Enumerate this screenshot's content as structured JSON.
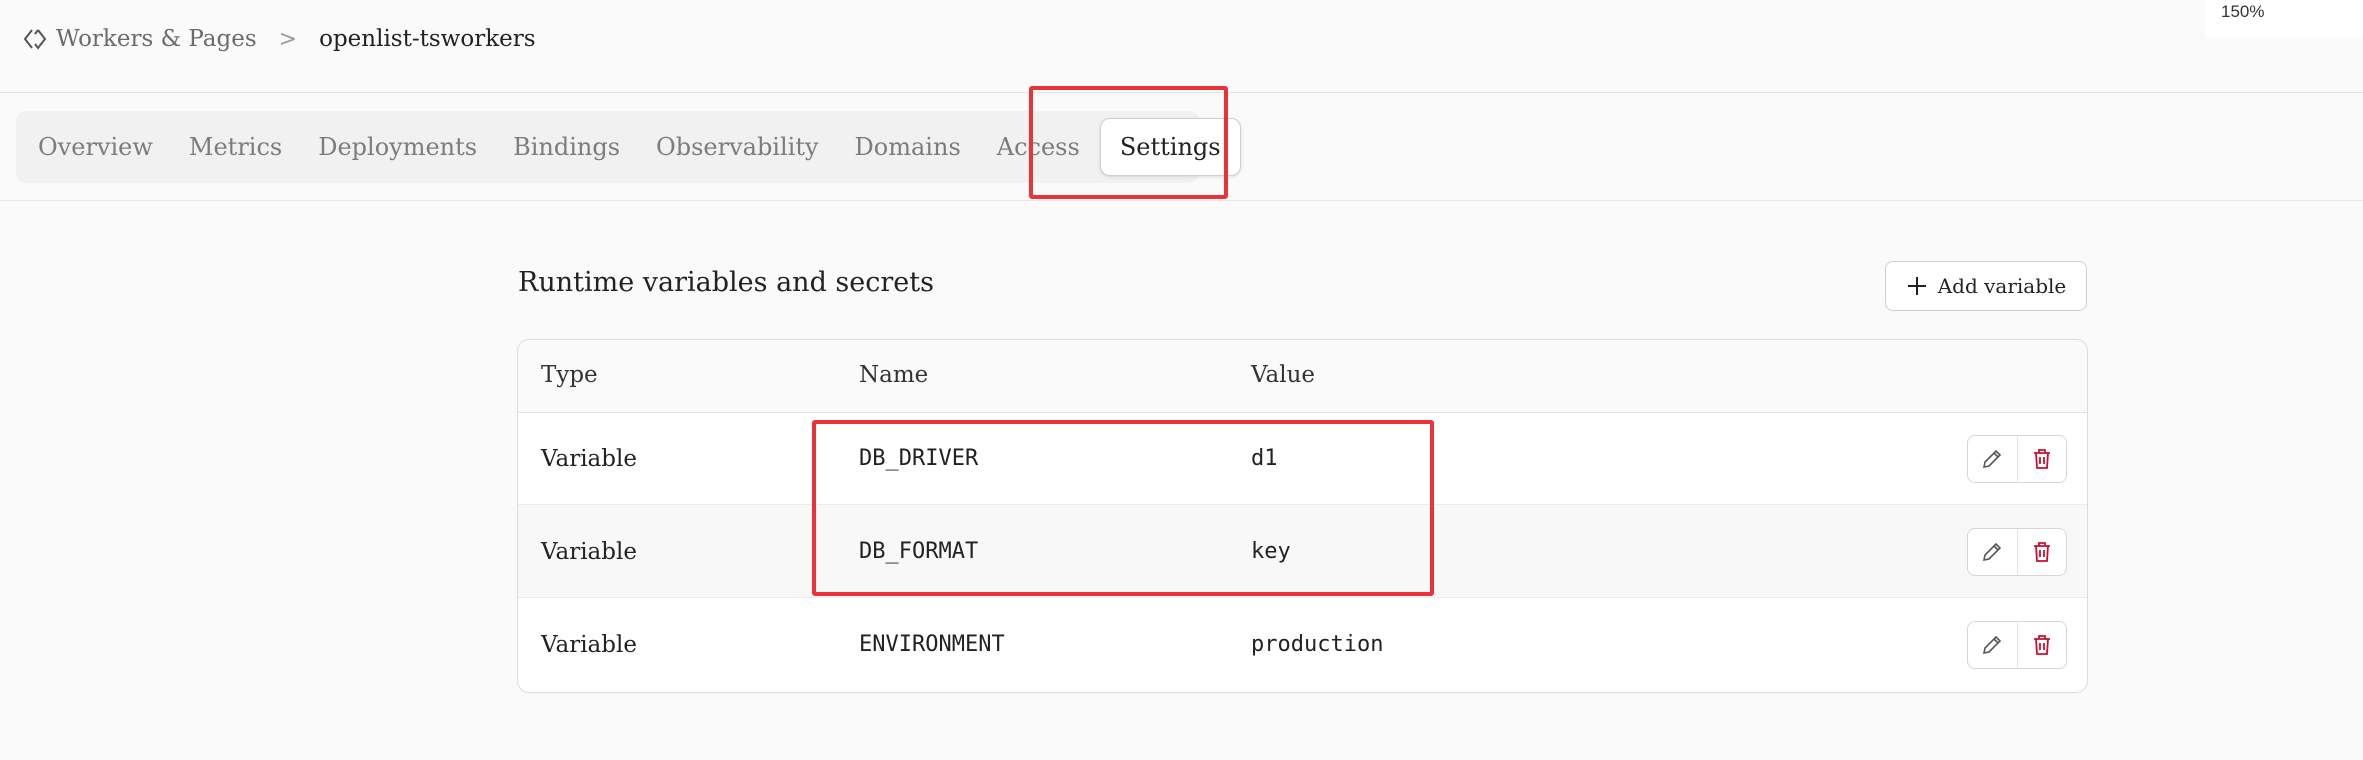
{
  "zoom": "150%",
  "breadcrumb": {
    "parent": "Workers & Pages",
    "separator": ">",
    "current": "openlist-tsworkers"
  },
  "tabs": [
    {
      "label": "Overview"
    },
    {
      "label": "Metrics"
    },
    {
      "label": "Deployments"
    },
    {
      "label": "Bindings"
    },
    {
      "label": "Observability"
    },
    {
      "label": "Domains"
    },
    {
      "label": "Access"
    },
    {
      "label": "Settings",
      "active": true
    }
  ],
  "section": {
    "title": "Runtime variables and secrets",
    "add_button": "Add variable"
  },
  "table": {
    "columns": [
      "Type",
      "Name",
      "Value"
    ],
    "rows": [
      {
        "type": "Variable",
        "name": "DB_DRIVER",
        "value": "d1"
      },
      {
        "type": "Variable",
        "name": "DB_FORMAT",
        "value": "key"
      },
      {
        "type": "Variable",
        "name": "ENVIRONMENT",
        "value": "production"
      }
    ]
  },
  "colors": {
    "highlight": "#e8333a",
    "delete_icon": "#c8102e"
  },
  "icons": [
    "workers-icon",
    "plus-icon",
    "edit-icon",
    "delete-icon"
  ]
}
